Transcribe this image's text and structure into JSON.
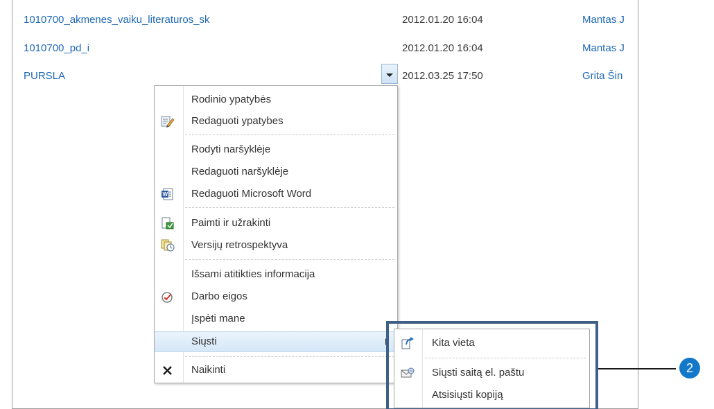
{
  "rows": [
    {
      "name": "1010700_akmenes_vaiku_literaturos_sk",
      "date": "2012.01.20 16:04",
      "author": "Mantas J"
    },
    {
      "name": "1010700_pd_i",
      "date": "2012.01.20 16:04",
      "author": "Mantas J"
    },
    {
      "name": "PURSLA",
      "date": "2012.03.25 17:50",
      "author": "Grita Šin"
    }
  ],
  "context_menu": {
    "items": [
      {
        "label": "Rodinio ypatybės",
        "icon": ""
      },
      {
        "label": "Redaguoti ypatybes",
        "icon": "edit-properties-icon"
      },
      {
        "label": "Rodyti naršyklėje",
        "icon": ""
      },
      {
        "label": "Redaguoti naršyklėje",
        "icon": ""
      },
      {
        "label": "Redaguoti Microsoft Word",
        "icon": "word-icon"
      },
      {
        "label": "Paimti ir užrakinti",
        "icon": "check-out-icon"
      },
      {
        "label": "Versijų retrospektyva",
        "icon": "version-history-icon"
      },
      {
        "label": "Išsami atitikties informacija",
        "icon": ""
      },
      {
        "label": "Darbo eigos",
        "icon": "workflow-icon"
      },
      {
        "label": "Įspėti mane",
        "icon": ""
      },
      {
        "label": "Siųsti",
        "icon": "",
        "highlighted": true,
        "has_submenu": true
      },
      {
        "label": "Naikinti",
        "icon": "delete-icon"
      }
    ]
  },
  "send_submenu": {
    "items": [
      {
        "label": "Kita vieta",
        "icon": "other-location-icon"
      },
      {
        "label": "Siųsti saitą el. paštu",
        "icon": "email-link-icon"
      },
      {
        "label": "Atsisiųsti kopiją",
        "icon": ""
      }
    ]
  },
  "callout": {
    "number": "2",
    "color": "#1478c9",
    "box_color": "#3e5f86"
  },
  "colors": {
    "link": "#1f68b5",
    "highlight": "#d5e7f8"
  }
}
